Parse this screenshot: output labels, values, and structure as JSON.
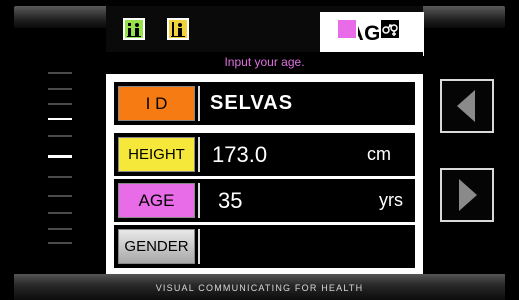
{
  "header": {
    "title": "AGE",
    "icons": [
      {
        "name": "info-person-icon",
        "bg": "#96e04a"
      },
      {
        "name": "height-person-icon",
        "bg": "#f2d23a"
      },
      {
        "name": "group-chart-icon",
        "bg": "#e86ce8"
      },
      {
        "name": "gender-symbol-icon",
        "bg": "#000000"
      }
    ]
  },
  "hint": "Input your age.",
  "form": {
    "rows": [
      {
        "label": "I D",
        "value": "SELVAS",
        "unit": "",
        "color": "#f57b12"
      },
      {
        "label": "HEIGHT",
        "value": "173.0",
        "unit": "cm",
        "color": "#f5e83a"
      },
      {
        "label": "AGE",
        "value": "35",
        "unit": "yrs",
        "color": "#e86ce8"
      },
      {
        "label": "GENDER",
        "value": "",
        "unit": "",
        "color": "#cfcfcf"
      }
    ]
  },
  "level_indicator": {
    "marks": 10,
    "active_marks": [
      3,
      5
    ]
  },
  "nav": {
    "prev_icon": "triangle-left-icon",
    "next_icon": "triangle-right-icon"
  },
  "footer": "VISUAL COMMUNICATING FOR HEALTH",
  "colors": {
    "accent_text": "#e070e0",
    "panel": "#ffffff",
    "background": "#000000"
  }
}
